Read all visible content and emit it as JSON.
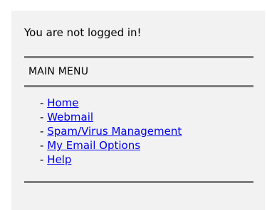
{
  "status_text": "You are not logged in!",
  "main_menu": {
    "title": "MAIN MENU",
    "bullet": "- ",
    "items": [
      {
        "label": "Home"
      },
      {
        "label": "Webmail"
      },
      {
        "label": "Spam/Virus Management"
      },
      {
        "label": "My Email Options"
      },
      {
        "label": "Help"
      }
    ]
  },
  "colors": {
    "panel_background": "#f2f2f2",
    "rule": "#7f7f7f",
    "link": "#0000ee"
  }
}
